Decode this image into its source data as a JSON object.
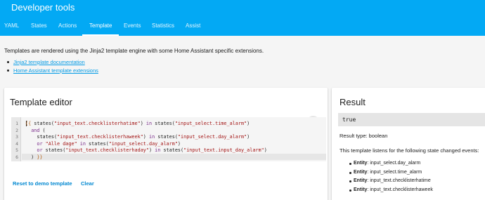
{
  "app": {
    "title": "Developer tools"
  },
  "tabs": [
    {
      "label": "YAML",
      "active": false
    },
    {
      "label": "States",
      "active": false
    },
    {
      "label": "Actions",
      "active": false
    },
    {
      "label": "Template",
      "active": true
    },
    {
      "label": "Events",
      "active": false
    },
    {
      "label": "Statistics",
      "active": false
    },
    {
      "label": "Assist",
      "active": false
    }
  ],
  "intro": {
    "text": "Templates are rendered using the Jinja2 template engine with some Home Assistant specific extensions.",
    "links": [
      "Jinja2 template documentation",
      "Home Assistant template extensions"
    ]
  },
  "editor": {
    "title": "Template editor",
    "expand_icon": "expand-icon",
    "line_numbers": [
      "1",
      "2",
      "3",
      "4",
      "5",
      "6"
    ],
    "code": [
      "{{ states(\"input_text.checklisterhatime\") in states(\"input_select.time_alarm\")",
      "  and (",
      "    states(\"input_text.checklisterhaweek\") in states(\"input_select.day_alarm\")",
      "    or \"Alle dage\" in states(\"input_select.day_alarm\")",
      "    or states(\"input_text.checklisterhaday\") in states(\"input_text.input_day_alarm\")",
      "  ) }}"
    ],
    "reset_label": "Reset to demo template",
    "clear_label": "Clear"
  },
  "result": {
    "title": "Result",
    "value": "true",
    "type_text": "Result type: boolean",
    "listen_text": "This template listens for the following state changed events:",
    "entity_label": "Entity",
    "entities": [
      "input_select.day_alarm",
      "input_select.time_alarm",
      "input_text.checklisterhatime",
      "input_text.checklisterhaweek"
    ]
  },
  "colors": {
    "accent": "#03a9f4",
    "link": "#039be5",
    "button": "#0288d1",
    "jinja_delimiter": "#b5651d",
    "string": "#a31515",
    "keyword": "#7b2d8b"
  }
}
